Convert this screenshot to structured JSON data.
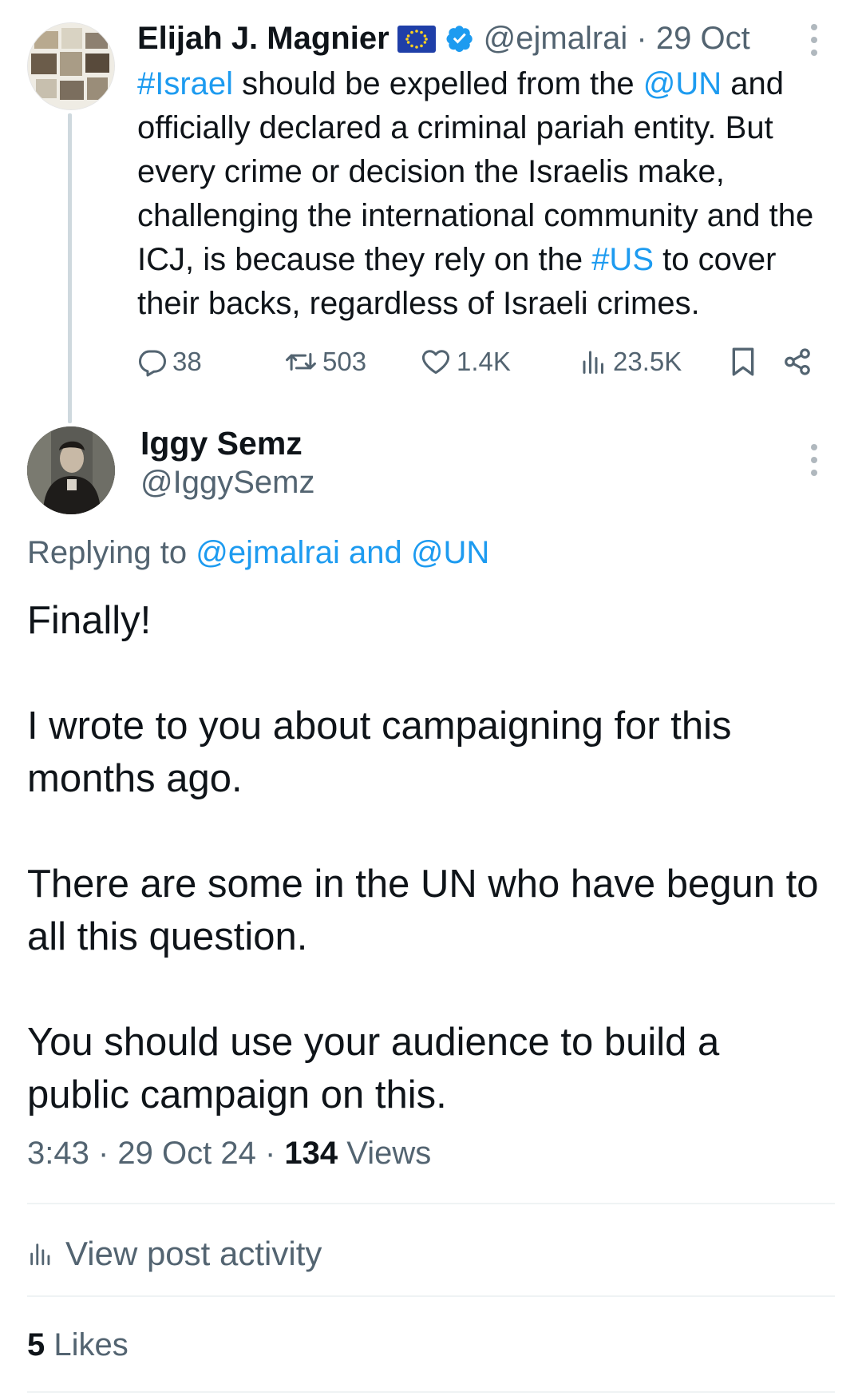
{
  "parent_tweet": {
    "author_name": "Elijah J. Magnier",
    "flag_icon": "eu-flag-icon",
    "verified_icon": "verified-badge-icon",
    "handle": "@ejmalrai",
    "separator": " · ",
    "date": "29 Oct",
    "text": {
      "seg1": "#Israel",
      "seg2": " should be expelled from the ",
      "seg3": "@UN",
      "seg4": " and officially declared a criminal pariah entity. But every crime or decision the Israelis make, challenging the international community and the ICJ, is because they rely on the ",
      "seg5": "#US",
      "seg6": " to cover their backs, regardless of Israeli crimes."
    },
    "actions": {
      "replies": "38",
      "reposts": "503",
      "likes": "1.4K",
      "views": "23.5K"
    }
  },
  "reply_tweet": {
    "author_name": "Iggy Semz",
    "handle": "@IggySemz",
    "replying_prefix": "Replying to ",
    "replying_to": "@ejmalrai and @UN",
    "body": {
      "p1": "Finally!",
      "p2": "I wrote to you about campaigning for this months ago.",
      "p3": "There are some in the UN who have begun to all this question.",
      "p4": "You should use your audience to build a public campaign on this."
    },
    "time": "3:43",
    "separator": " · ",
    "date": "29 Oct 24",
    "separator2": " · ",
    "views_count": "134",
    "views_label": " Views",
    "post_activity_label": "View post activity",
    "likes_count": "5",
    "likes_label": " Likes"
  },
  "colors": {
    "link": "#1d9bf0",
    "text": "#0f1419",
    "muted": "#536471",
    "divider": "#eff3f4",
    "thread_line": "#cfd9de"
  }
}
